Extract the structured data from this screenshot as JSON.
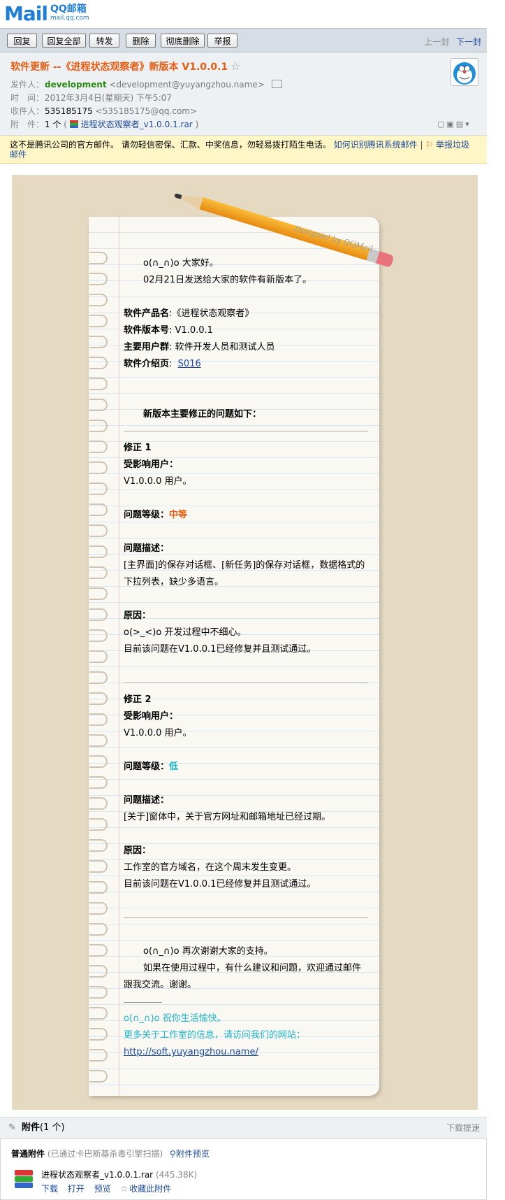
{
  "logo": {
    "word": "Mail",
    "cn": "QQ邮箱",
    "en": "mail.qq.com"
  },
  "toolbar": {
    "reply": "回复",
    "reply_all": "回复全部",
    "forward": "转发",
    "delete": "删除",
    "delete_perm": "彻底删除",
    "report": "举报",
    "prev": "上一封",
    "next": "下一封"
  },
  "header": {
    "subject": "软件更新 --《进程状态观察者》新版本 V1.0.0.1",
    "from_label": "发件人：",
    "from_name": "development",
    "from_email": "<development@yuyangzhou.name>",
    "time_label": "时　间：",
    "time_value": "2012年3月4日(星期天) 下午5:07",
    "to_label": "收件人：",
    "to_name": "535185175",
    "to_email": "<535185175@qq.com>",
    "att_label": "附　件：",
    "att_count": "1 个",
    "att_paren_open": "(",
    "att_paren_close": ")",
    "att_file": "进程状态观察者_v1.0.0.1.rar"
  },
  "warning": {
    "text": "这不是腾讯公司的官方邮件。 请勿轻信密保、汇款、中奖信息，勿轻易拨打陌生电话。",
    "link1": "如何识别腾讯系统邮件",
    "sep": "|",
    "link2": "举报垃圾邮件"
  },
  "letter": {
    "designed_by": "Designed by QQMail",
    "greeting": "o(∩_∩)o  大家好。",
    "intro": "02月21日发送给大家的软件有新版本了。",
    "product_label": "软件产品名",
    "product_value": ":《进程状态观察者》",
    "version_label": "软件版本号",
    "version_value": ": V1.0.0.1",
    "users_label": "主要用户群",
    "users_value": ": 软件开发人员和测试人员",
    "page_label": "软件介绍页",
    "page_colon": ":",
    "page_link": "S016",
    "fix_heading": "新版本主要修正的问题如下：",
    "fix1": {
      "title": "修正 1",
      "users_label": "受影响用户：",
      "users_value": "V1.0.0.0 用户。",
      "level_label": "问题等级：",
      "level_value": "中等",
      "desc_label": "问题描述：",
      "desc_value": "[主界面]的保存对话框、[新任务]的保存对话框，数据格式的下拉列表，缺少多语言。",
      "cause_label": "原因：",
      "cause_value": "o(>_<)o  开发过程中不细心。",
      "status": "目前该问题在V1.0.0.1已经修复并且测试通过。"
    },
    "fix2": {
      "title": "修正 2",
      "users_label": "受影响用户：",
      "users_value": "V1.0.0.0 用户。",
      "level_label": "问题等级：",
      "level_value": "低",
      "desc_label": "问题描述：",
      "desc_value": "[关于]窗体中，关于官方网址和邮箱地址已经过期。",
      "cause_label": "原因：",
      "cause_value": "工作室的官方域名，在这个周末发生变更。",
      "status": "目前该问题在V1.0.0.1已经修复并且测试通过。"
    },
    "thanks": "o(∩_∩)o 再次谢谢大家的支持。",
    "feedback": "如果在使用过程中，有什么建议和问题，欢迎通过邮件跟我交流。谢谢。",
    "wish": "o(∩_∩)o  祝你生活愉快。",
    "more": "更多关于工作室的信息，请访问我们的网站：",
    "url": "http://soft.yuyangzhou.name/"
  },
  "attachments": {
    "title": "附件",
    "count": "(1 个)",
    "speed": "下载提速",
    "normal_label": "普通附件",
    "scan_note": "(已通过卡巴斯基杀毒引擎扫描)",
    "preview_all": "附件预览",
    "file_name": "进程状态观察者_v1.0.0.1.rar",
    "file_size": "(445.38K)",
    "download": "下载",
    "open": "打开",
    "preview": "预览",
    "collect": "收藏此附件"
  },
  "colors": {
    "subject": "#e65d12",
    "sender": "#2a8a14",
    "level_mid": "#e65d12",
    "level_low": "#1fb4c8",
    "link": "#1d4a9a"
  },
  "icons": [
    "star-icon",
    "contact-card-icon",
    "paperclip-icon",
    "rar-file-icon",
    "search-icon",
    "star-outline-icon",
    "report-icon",
    "avatar-icon"
  ]
}
